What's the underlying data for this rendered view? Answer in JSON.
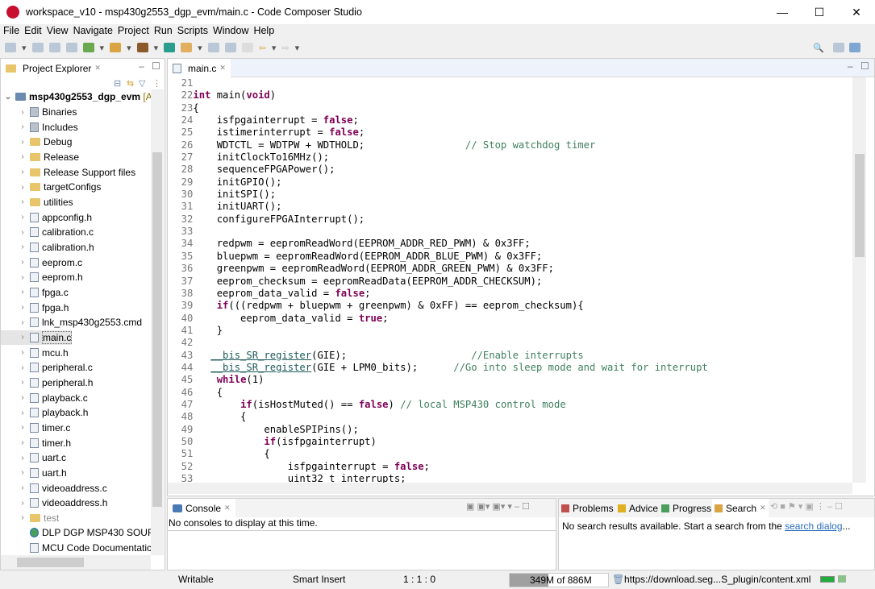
{
  "window": {
    "title": "workspace_v10 - msp430g2553_dgp_evm/main.c - Code Composer Studio",
    "minimize": "—",
    "maximize": "☐",
    "close": "✕"
  },
  "menu": [
    "File",
    "Edit",
    "View",
    "Navigate",
    "Project",
    "Run",
    "Scripts",
    "Window",
    "Help"
  ],
  "project_explorer": {
    "title": "Project Explorer",
    "root": "msp430g2553_dgp_evm",
    "root_suffix": "[A",
    "items": [
      {
        "label": "Binaries",
        "kind": "binaries"
      },
      {
        "label": "Includes",
        "kind": "includes"
      },
      {
        "label": "Debug",
        "kind": "folder"
      },
      {
        "label": "Release",
        "kind": "folder"
      },
      {
        "label": "Release Support files",
        "kind": "folder"
      },
      {
        "label": "targetConfigs",
        "kind": "folder"
      },
      {
        "label": "utilities",
        "kind": "folder"
      },
      {
        "label": "appconfig.h",
        "kind": "file"
      },
      {
        "label": "calibration.c",
        "kind": "file"
      },
      {
        "label": "calibration.h",
        "kind": "file"
      },
      {
        "label": "eeprom.c",
        "kind": "file"
      },
      {
        "label": "eeprom.h",
        "kind": "file"
      },
      {
        "label": "fpga.c",
        "kind": "file"
      },
      {
        "label": "fpga.h",
        "kind": "file"
      },
      {
        "label": "lnk_msp430g2553.cmd",
        "kind": "file"
      },
      {
        "label": "main.c",
        "kind": "file",
        "selected": true
      },
      {
        "label": "mcu.h",
        "kind": "file"
      },
      {
        "label": "peripheral.c",
        "kind": "file"
      },
      {
        "label": "peripheral.h",
        "kind": "file"
      },
      {
        "label": "playback.c",
        "kind": "file"
      },
      {
        "label": "playback.h",
        "kind": "file"
      },
      {
        "label": "timer.c",
        "kind": "file"
      },
      {
        "label": "timer.h",
        "kind": "file"
      },
      {
        "label": "uart.c",
        "kind": "file"
      },
      {
        "label": "uart.h",
        "kind": "file"
      },
      {
        "label": "videoaddress.c",
        "kind": "file"
      },
      {
        "label": "videoaddress.h",
        "kind": "file"
      },
      {
        "label": "test",
        "kind": "folder-gray"
      },
      {
        "label": "DLP DGP MSP430 SOURC",
        "kind": "globe",
        "noexpand": true
      },
      {
        "label": "MCU Code Documentatic",
        "kind": "doc",
        "noexpand": true
      }
    ]
  },
  "editor": {
    "tab": "main.c",
    "first_line": 21,
    "lines": [
      "",
      "int main(void)",
      "{",
      "    isfpgainterrupt = false;",
      "    istimerinterrupt = false;",
      "    WDTCTL = WDTPW + WDTHOLD;                 // Stop watchdog timer",
      "    initClockTo16MHz();",
      "    sequenceFPGAPower();",
      "    initGPIO();",
      "    initSPI();",
      "    initUART();",
      "    configureFPGAInterrupt();",
      "",
      "    redpwm = eepromReadWord(EEPROM_ADDR_RED_PWM) & 0x3FF;",
      "    bluepwm = eepromReadWord(EEPROM_ADDR_BLUE_PWM) & 0x3FF;",
      "    greenpwm = eepromReadWord(EEPROM_ADDR_GREEN_PWM) & 0x3FF;",
      "    eeprom_checksum = eepromReadData(EEPROM_ADDR_CHECKSUM);",
      "    eeprom_data_valid = false;",
      "    if(((redpwm + bluepwm + greenpwm) & 0xFF) == eeprom_checksum){",
      "        eeprom_data_valid = true;",
      "    }",
      "",
      "   __bis_SR_register(GIE);                     //Enable interrupts",
      "   __bis_SR_register(GIE + LPM0_bits);      //Go into sleep mode and wait for interrupt",
      "    while(1)",
      "    {",
      "        if(isHostMuted() == false) // local MSP430 control mode",
      "        {",
      "            enableSPIPins();",
      "            if(isfpgainterrupt)",
      "            {",
      "                isfpgainterrupt = false;",
      "                uint32_t interrupts;"
    ]
  },
  "console": {
    "tab": "Console",
    "message": "No consoles to display at this time."
  },
  "views": {
    "tabs": [
      "Problems",
      "Advice",
      "Progress",
      "Search"
    ],
    "message": "No search results available. Start a search from the ",
    "link": "search dialog",
    "ellipsis": "..."
  },
  "status": {
    "mode": "Writable",
    "insert": "Smart Insert",
    "position": "1 : 1 : 0",
    "heap": "349M of 886M",
    "heap_used_fraction": 0.39,
    "url": "https://download.seg...S_plugin/content.xml"
  }
}
